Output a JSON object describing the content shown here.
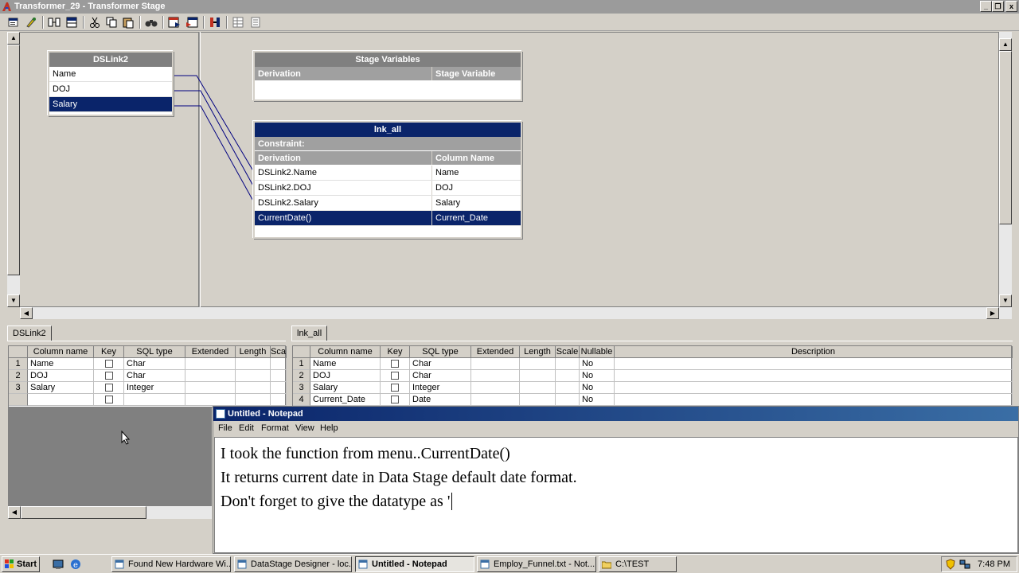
{
  "window": {
    "title": "Transformer_29 - Transformer Stage",
    "controls": [
      "_",
      "❐",
      "x"
    ]
  },
  "input_link": {
    "name": "DSLink2",
    "columns": [
      "Name",
      "DOJ",
      "Salary"
    ],
    "selected": "Salary"
  },
  "stage_variables": {
    "title": "Stage Variables",
    "col_derivation": "Derivation",
    "col_variable": "Stage Variable"
  },
  "output_link": {
    "name": "lnk_all",
    "constraint_label": "Constraint:",
    "col_derivation": "Derivation",
    "col_column": "Column Name",
    "rows": [
      {
        "derivation": "DSLink2.Name",
        "column": "Name"
      },
      {
        "derivation": "DSLink2.DOJ",
        "column": "DOJ"
      },
      {
        "derivation": "DSLink2.Salary",
        "column": "Salary"
      },
      {
        "derivation": "CurrentDate()",
        "column": "Current_Date"
      }
    ]
  },
  "left_grid": {
    "tab": "DSLink2",
    "headers": [
      "Column name",
      "Key",
      "SQL type",
      "Extended",
      "Length",
      "Sca"
    ],
    "rows": [
      {
        "n": "1",
        "name": "Name",
        "type": "Char"
      },
      {
        "n": "2",
        "name": "DOJ",
        "type": "Char"
      },
      {
        "n": "3",
        "name": "Salary",
        "type": "Integer"
      }
    ]
  },
  "right_grid": {
    "tab": "lnk_all",
    "headers": [
      "Column name",
      "Key",
      "SQL type",
      "Extended",
      "Length",
      "Scale",
      "Nullable",
      "Description"
    ],
    "rows": [
      {
        "n": "1",
        "name": "Name",
        "type": "Char",
        "nullable": "No"
      },
      {
        "n": "2",
        "name": "DOJ",
        "type": "Char",
        "nullable": "No"
      },
      {
        "n": "3",
        "name": "Salary",
        "type": "Integer",
        "nullable": "No"
      },
      {
        "n": "4",
        "name": "Current_Date",
        "type": "Date",
        "nullable": "No"
      }
    ]
  },
  "notepad": {
    "title": "Untitled - Notepad",
    "menu": [
      "File",
      "Edit",
      "Format",
      "View",
      "Help"
    ],
    "lines": [
      "I took the function from menu..CurrentDate()",
      "It returns current date in Data Stage default date format.",
      "Don't forget to give the datatype as '"
    ]
  },
  "taskbar": {
    "start": "Start",
    "tasks": [
      {
        "label": "Found New Hardware Wi...",
        "active": false
      },
      {
        "label": "DataStage Designer - loc...",
        "active": false
      },
      {
        "label": "Untitled - Notepad",
        "active": true
      },
      {
        "label": "Employ_Funnel.txt - Not...",
        "active": false
      },
      {
        "label": "C:\\TEST",
        "active": false
      }
    ],
    "clock": "7:48 PM"
  },
  "colors": {
    "selection": "#0a246a",
    "header_gray": "#808080",
    "link_line": "#000080"
  }
}
